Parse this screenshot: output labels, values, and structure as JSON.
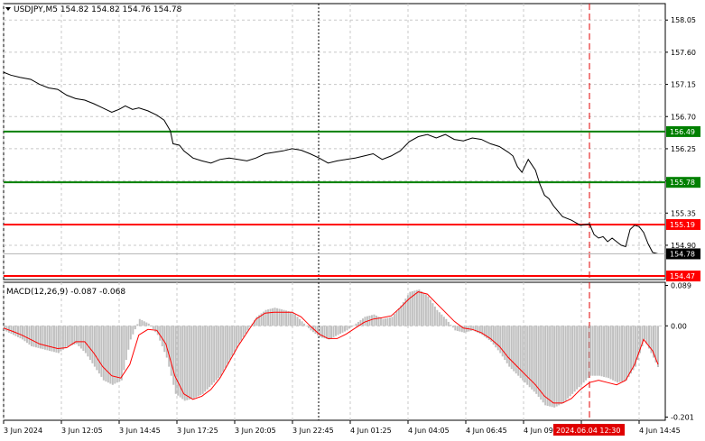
{
  "chart_data": [
    {
      "type": "line",
      "panel": "price",
      "header": "USDJPY,M5  154.82 154.82 154.76 154.78",
      "y_ticks": [
        158.05,
        157.6,
        157.15,
        156.7,
        156.25,
        155.8,
        155.35,
        154.9
      ],
      "ylim": [
        154.42,
        158.28
      ],
      "x_labels": [
        "3 Jun 2024",
        "3 Jun 12:05",
        "3 Jun 14:45",
        "3 Jun 17:25",
        "3 Jun 20:05",
        "3 Jun 22:45",
        "4 Jun 01:25",
        "4 Jun 04:05",
        "4 Jun 06:45",
        "4 Jun 09",
        "2024.06.04 12:30",
        "4 Jun 14:45"
      ],
      "last_price": 154.78,
      "levels": [
        {
          "value": 156.49,
          "label": "156.49",
          "color": "#008000"
        },
        {
          "value": 155.78,
          "label": "155.78",
          "color": "#008000"
        },
        {
          "value": 155.19,
          "label": "155.19",
          "color": "#ff0000"
        },
        {
          "value": 154.47,
          "label": "154.47",
          "color": "#ff0000"
        }
      ],
      "series": [
        {
          "color": "#000000",
          "x": [
            0,
            8,
            18,
            30,
            40,
            50,
            60,
            70,
            80,
            90,
            100,
            110,
            120,
            128,
            135,
            143,
            150,
            160,
            170,
            178,
            185,
            188,
            195,
            200,
            210,
            220,
            230,
            240,
            250,
            260,
            270,
            280,
            290,
            300,
            310,
            320,
            330,
            340,
            350,
            360,
            370,
            380,
            390,
            400,
            410,
            420,
            430,
            440,
            450,
            460,
            470,
            480,
            490,
            500,
            510,
            520,
            530,
            540,
            550,
            560,
            565,
            570,
            575,
            582,
            590,
            595,
            600,
            605,
            610,
            620,
            630,
            640,
            650,
            655,
            660,
            665,
            670,
            675,
            680,
            685,
            690,
            695,
            700,
            705,
            710,
            715,
            720,
            726
          ],
          "values": [
            157.32,
            157.28,
            157.25,
            157.22,
            157.15,
            157.1,
            157.08,
            157.0,
            156.95,
            156.93,
            156.88,
            156.82,
            156.76,
            156.8,
            156.85,
            156.8,
            156.82,
            156.78,
            156.72,
            156.65,
            156.5,
            156.32,
            156.3,
            156.22,
            156.12,
            156.08,
            156.05,
            156.1,
            156.12,
            156.1,
            156.08,
            156.12,
            156.18,
            156.2,
            156.22,
            156.25,
            156.23,
            156.18,
            156.12,
            156.05,
            156.08,
            156.1,
            156.12,
            156.15,
            156.18,
            156.1,
            156.15,
            156.22,
            156.35,
            156.42,
            156.45,
            156.4,
            156.45,
            156.38,
            156.36,
            156.4,
            156.38,
            156.32,
            156.28,
            156.2,
            156.15,
            156.0,
            155.92,
            156.1,
            155.95,
            155.75,
            155.6,
            155.55,
            155.45,
            155.3,
            155.25,
            155.18,
            155.2,
            155.05,
            155.0,
            155.02,
            154.95,
            155.0,
            154.95,
            154.9,
            154.88,
            155.12,
            155.18,
            155.16,
            155.08,
            154.92,
            154.8,
            154.78
          ]
        }
      ]
    },
    {
      "type": "bar",
      "panel": "indicator",
      "header": "MACD(12,26,9) -0.087 -0.068",
      "y_ticks": [
        0.089,
        0.0,
        -0.201
      ],
      "ylim": [
        -0.208,
        0.096
      ],
      "series": [
        {
          "name": "",
          "color": "#c0c0c0",
          "x": [
            0,
            10,
            20,
            30,
            40,
            50,
            60,
            70,
            80,
            90,
            100,
            110,
            120,
            130,
            140,
            150,
            160,
            170,
            180,
            190,
            200,
            210,
            220,
            230,
            240,
            250,
            260,
            270,
            280,
            290,
            300,
            310,
            320,
            330,
            340,
            350,
            360,
            370,
            380,
            390,
            400,
            410,
            420,
            430,
            440,
            450,
            460,
            470,
            480,
            490,
            500,
            510,
            520,
            530,
            540,
            550,
            560,
            570,
            580,
            590,
            600,
            610,
            620,
            630,
            640,
            650,
            660,
            670,
            680,
            690,
            700,
            710,
            720,
            726
          ],
          "values": [
            -0.01,
            -0.02,
            -0.03,
            -0.045,
            -0.05,
            -0.055,
            -0.06,
            -0.045,
            -0.04,
            -0.06,
            -0.09,
            -0.12,
            -0.13,
            -0.12,
            -0.03,
            0.015,
            0.005,
            -0.02,
            -0.07,
            -0.15,
            -0.165,
            -0.16,
            -0.15,
            -0.13,
            -0.11,
            -0.075,
            -0.04,
            -0.01,
            0.02,
            0.035,
            0.04,
            0.035,
            0.03,
            0.01,
            -0.01,
            -0.025,
            -0.03,
            -0.02,
            -0.01,
            0.005,
            0.02,
            0.025,
            0.015,
            0.02,
            0.045,
            0.075,
            0.08,
            0.065,
            0.035,
            0.015,
            -0.01,
            -0.015,
            -0.01,
            -0.02,
            -0.035,
            -0.06,
            -0.09,
            -0.11,
            -0.13,
            -0.15,
            -0.175,
            -0.18,
            -0.17,
            -0.15,
            -0.13,
            -0.11,
            -0.11,
            -0.115,
            -0.125,
            -0.12,
            -0.09,
            -0.03,
            -0.07,
            -0.095
          ]
        },
        {
          "name": "",
          "color": "#ff0000",
          "x": [
            0,
            10,
            20,
            30,
            40,
            50,
            60,
            70,
            80,
            90,
            100,
            110,
            120,
            130,
            140,
            150,
            160,
            170,
            180,
            190,
            200,
            210,
            220,
            230,
            240,
            250,
            260,
            270,
            280,
            290,
            300,
            310,
            320,
            330,
            340,
            350,
            360,
            370,
            380,
            390,
            400,
            410,
            420,
            430,
            440,
            450,
            460,
            470,
            480,
            490,
            500,
            510,
            520,
            530,
            540,
            550,
            560,
            570,
            580,
            590,
            600,
            610,
            620,
            630,
            640,
            650,
            660,
            670,
            680,
            690,
            700,
            710,
            720,
            726
          ],
          "values": [
            -0.005,
            -0.012,
            -0.02,
            -0.03,
            -0.04,
            -0.045,
            -0.05,
            -0.048,
            -0.035,
            -0.035,
            -0.06,
            -0.09,
            -0.11,
            -0.115,
            -0.085,
            -0.02,
            -0.008,
            -0.01,
            -0.04,
            -0.11,
            -0.15,
            -0.162,
            -0.155,
            -0.14,
            -0.115,
            -0.08,
            -0.045,
            -0.015,
            0.015,
            0.028,
            0.03,
            0.03,
            0.03,
            0.02,
            0.0,
            -0.018,
            -0.028,
            -0.028,
            -0.018,
            -0.005,
            0.008,
            0.015,
            0.018,
            0.022,
            0.04,
            0.06,
            0.075,
            0.07,
            0.05,
            0.03,
            0.01,
            -0.005,
            -0.008,
            -0.015,
            -0.028,
            -0.045,
            -0.07,
            -0.09,
            -0.11,
            -0.13,
            -0.155,
            -0.17,
            -0.17,
            -0.16,
            -0.14,
            -0.125,
            -0.12,
            -0.125,
            -0.13,
            -0.12,
            -0.085,
            -0.03,
            -0.055,
            -0.085
          ]
        }
      ]
    }
  ]
}
